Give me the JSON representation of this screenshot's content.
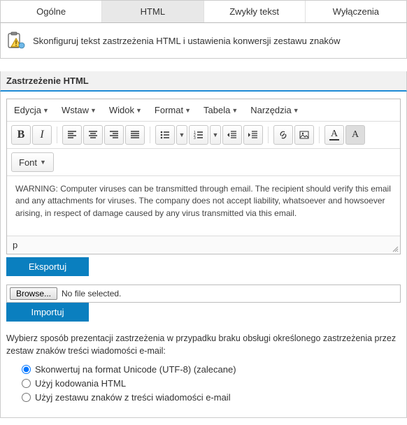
{
  "tabs": {
    "general": "Ogólne",
    "html": "HTML",
    "plain": "Zwykły tekst",
    "exclusions": "Wyłączenia"
  },
  "infoText": "Skonfiguruj tekst zastrzeżenia HTML i ustawienia konwersji zestawu znaków",
  "sectionTitle": "Zastrzeżenie HTML",
  "menu": {
    "edit": "Edycja",
    "insert": "Wstaw",
    "view": "Widok",
    "format": "Format",
    "table": "Tabela",
    "tools": "Narzędzia"
  },
  "fontLabel": "Font",
  "editorContent": "WARNING: Computer viruses can be transmitted through email. The recipient should verify this email and any attachments for viruses. The company does not accept liability, whatsoever and howsoever arising, in respect of damage caused by any virus transmitted via this email.",
  "statusPath": "p",
  "exportLabel": "Eksportuj",
  "browseLabel": "Browse...",
  "noFileLabel": "No file selected.",
  "importLabel": "Importuj",
  "helpText": "Wybierz sposób prezentacji zastrzeżenia w przypadku braku obsługi określonego zastrzeżenia przez zestaw znaków treści wiadomości e-mail:",
  "radios": {
    "utf8": "Skonwertuj na format Unicode (UTF-8) (zalecane)",
    "htmlenc": "Użyj kodowania HTML",
    "bodycs": "Użyj zestawu znaków z treści wiadomości e-mail"
  }
}
